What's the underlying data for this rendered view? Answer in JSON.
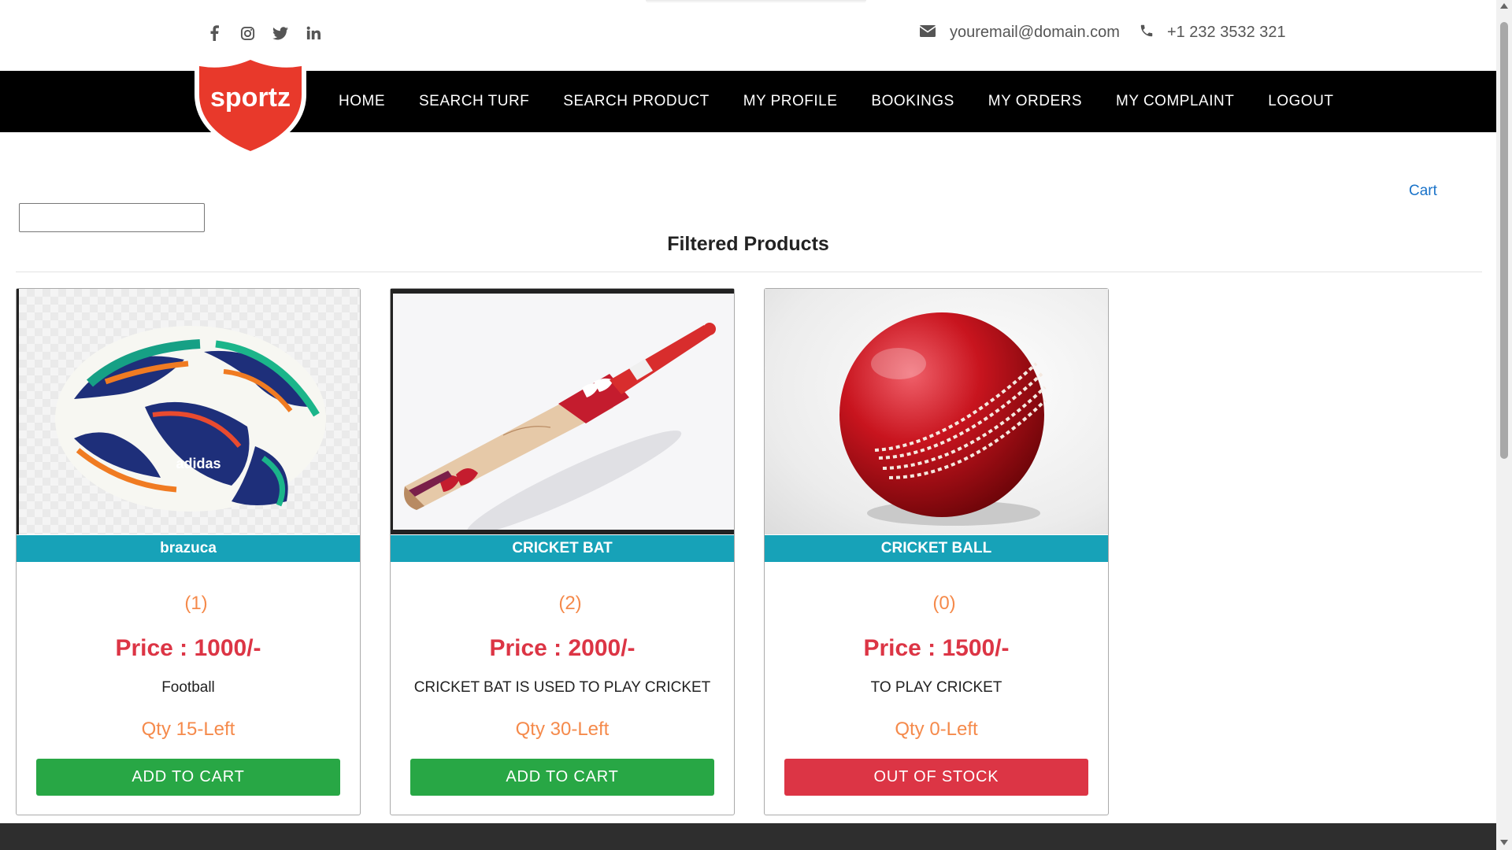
{
  "header": {
    "social_icons": [
      "facebook-icon",
      "instagram-icon",
      "twitter-icon",
      "linkedin-icon"
    ],
    "email": "youremail@domain.com",
    "phone": "+1 232 3532 321"
  },
  "logo": {
    "text": "sportz",
    "color": "#e8392b"
  },
  "nav": {
    "items": [
      {
        "label": "HOME"
      },
      {
        "label": "SEARCH TURF"
      },
      {
        "label": "SEARCH PRODUCT"
      },
      {
        "label": "MY PROFILE"
      },
      {
        "label": "BOOKINGS"
      },
      {
        "label": "MY ORDERS"
      },
      {
        "label": "MY COMPLAINT"
      },
      {
        "label": "LOGOUT"
      }
    ]
  },
  "main": {
    "cart_label": "Cart",
    "search_value": "",
    "title": "Filtered Products",
    "products": [
      {
        "name": "brazuca",
        "rating": "(1)",
        "price": "Price : 1000/-",
        "description": "Football",
        "qty": "Qty 15-Left",
        "button": "ADD TO CART",
        "in_stock": true
      },
      {
        "name": "CRICKET BAT",
        "rating": "(2)",
        "price": "Price : 2000/-",
        "description": "CRICKET BAT IS USED TO PLAY CRICKET",
        "qty": "Qty 30-Left",
        "button": "ADD TO CART",
        "in_stock": true
      },
      {
        "name": "CRICKET BALL",
        "rating": "(0)",
        "price": "Price : 1500/-",
        "description": "TO PLAY CRICKET",
        "qty": "Qty 0-Left",
        "button": "OUT OF STOCK",
        "in_stock": false
      }
    ]
  },
  "colors": {
    "nav_bg": "#000000",
    "product_name_bg": "#17a2b8",
    "price": "#dc3545",
    "accent_orange": "#f58a4b",
    "add_button": "#28a745",
    "out_button": "#dc3545",
    "link": "#1a73c9"
  }
}
